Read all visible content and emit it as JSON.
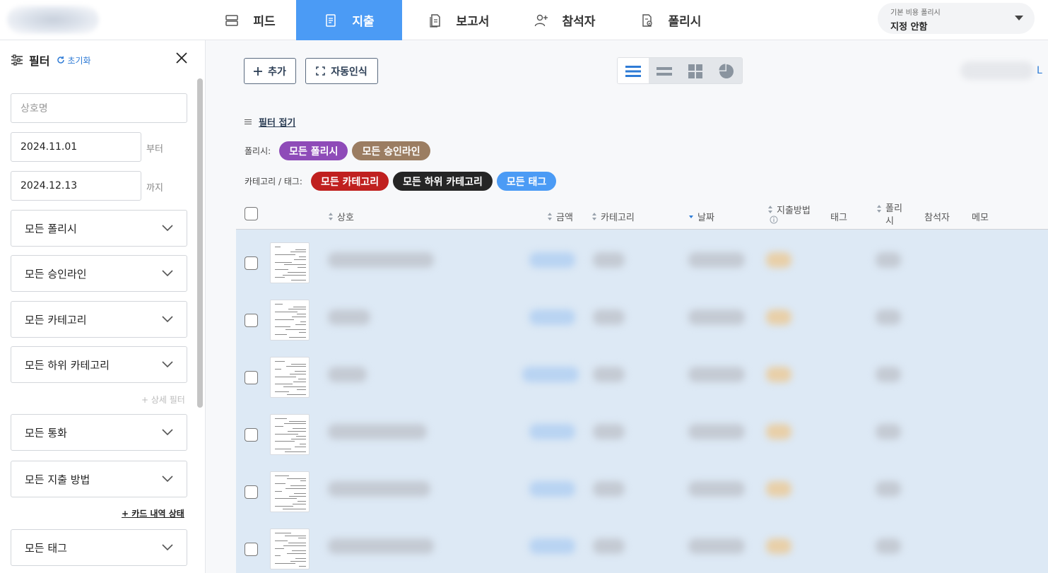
{
  "nav": {
    "items": [
      {
        "label": "피드",
        "icon": "feed-icon"
      },
      {
        "label": "지출",
        "icon": "receipt-icon",
        "active": true
      },
      {
        "label": "보고서",
        "icon": "report-icon"
      },
      {
        "label": "참석자",
        "icon": "add-person-icon"
      },
      {
        "label": "폴리시",
        "icon": "policy-icon"
      }
    ],
    "active_color": "#4b9bf5",
    "policy_selector": {
      "label": "기본 비용 폴리시",
      "value": "지정 안함"
    }
  },
  "sidebar": {
    "title": "필터",
    "reset_label": "초기화",
    "merchant_placeholder": "상호명",
    "date_from": "2024.11.01",
    "date_from_suffix": "부터",
    "date_to": "2024.12.13",
    "date_to_suffix": "까지",
    "selects_top": [
      "모든 폴리시",
      "모든 승인라인",
      "모든 카테고리",
      "모든 하위 카테고리"
    ],
    "detail_filter_link": "+ 상세 필터",
    "selects_mid": [
      "모든 통화",
      "모든 지출 방법"
    ],
    "card_status_link": "+ 카드 내역 상태",
    "selects_bottom": [
      "모든 태그"
    ]
  },
  "toolbar": {
    "add_label": "추가",
    "auto_recognize_label": "자동인식",
    "view_modes": [
      "list-view-icon",
      "compact-view-icon",
      "grid-view-icon",
      "pie-chart-icon"
    ],
    "active_view": 0,
    "right_mark": "L"
  },
  "filters": {
    "fold_label": "필터 접기",
    "policy_label": "폴리시:",
    "policy_chips": [
      {
        "label": "모든 폴리시",
        "color": "#8e4bb8"
      },
      {
        "label": "모든 승인라인",
        "color": "#9b7d62"
      }
    ],
    "category_label": "카테고리 / 태그:",
    "category_chips": [
      {
        "label": "모든 카테고리",
        "color": "#c0201f"
      },
      {
        "label": "모든 하위 카테고리",
        "color": "#252525"
      },
      {
        "label": "모든 태그",
        "color": "#4b9bf5"
      }
    ]
  },
  "table": {
    "columns": {
      "merchant": "상호",
      "amount": "금액",
      "category": "카테고리",
      "date": "날짜",
      "payment_method": "지출방법",
      "tag": "태그",
      "policy": "폴리시",
      "attendees": "참석자",
      "memo": "메모"
    },
    "row_count": 6,
    "row_background": "#dde9f5"
  }
}
